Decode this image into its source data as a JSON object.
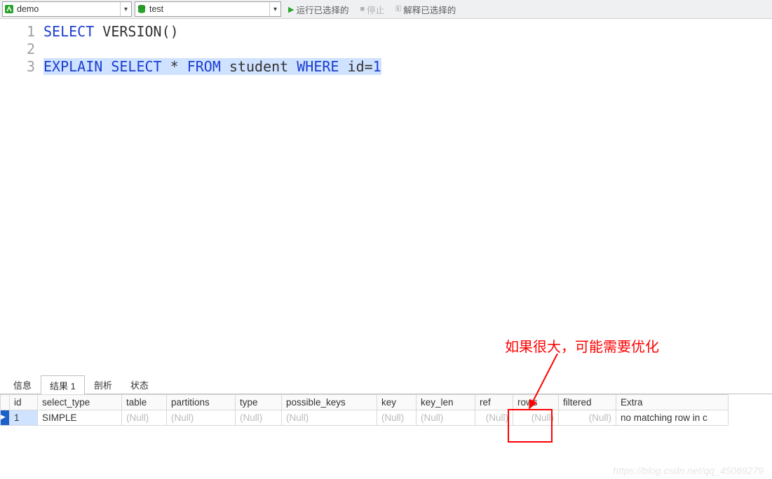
{
  "toolbar": {
    "connection": "demo",
    "database": "test",
    "run": "运行已选择的",
    "stop": "停止",
    "explain": "解释已选择的"
  },
  "editor": {
    "lines": [
      "1",
      "2",
      "3"
    ],
    "line1_kw1": "SELECT",
    "line1_rest": " VERSION()",
    "line3_kw1": "EXPLAIN",
    "line3_kw2": "SELECT",
    "line3_star": " * ",
    "line3_kw3": "FROM",
    "line3_tbl": " student ",
    "line3_kw4": "WHERE",
    "line3_cond_a": " id=",
    "line3_cond_b": "1"
  },
  "tabs": {
    "info": "信息",
    "result": "结果 1",
    "profile": "剖析",
    "status": "状态"
  },
  "grid": {
    "headers": [
      "id",
      "select_type",
      "table",
      "partitions",
      "type",
      "possible_keys",
      "key",
      "key_len",
      "ref",
      "rows",
      "filtered",
      "Extra"
    ],
    "row": {
      "id": "1",
      "select_type": "SIMPLE",
      "table": "(Null)",
      "partitions": "(Null)",
      "type": "(Null)",
      "possible_keys": "(Null)",
      "key": "(Null)",
      "key_len": "(Null)",
      "ref": "(Null)",
      "rows": "(Null)",
      "filtered": "(Null)",
      "Extra": "no matching row in c"
    }
  },
  "annotation": "如果很大，可能需要优化",
  "watermark": "https://blog.csdn.net/qq_45069279"
}
